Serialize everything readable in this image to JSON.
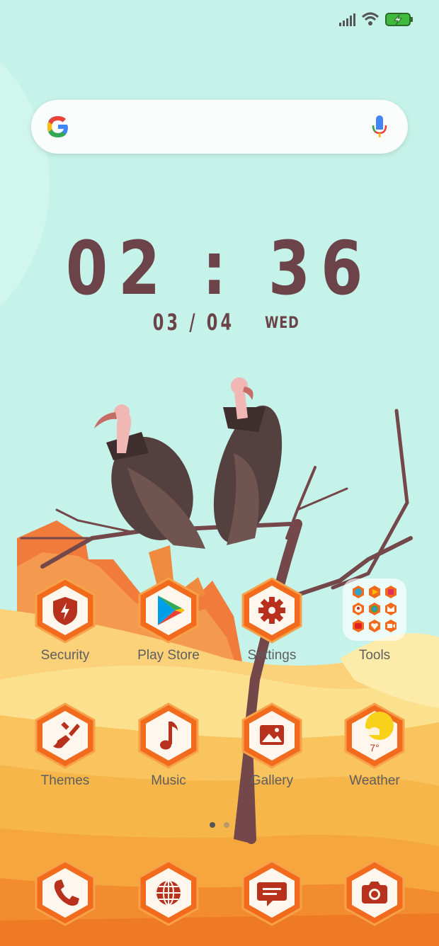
{
  "status_bar": {
    "icons": [
      "signal-icon",
      "wifi-icon",
      "battery-charging-icon"
    ]
  },
  "search": {
    "logo": "google-g-icon",
    "voice": "microphone-icon"
  },
  "clock": {
    "time": "02 : 36",
    "date": "03 / 04",
    "weekday": "WED"
  },
  "apps": {
    "security": "Security",
    "play_store": "Play Store",
    "settings": "Settings",
    "tools": "Tools",
    "themes": "Themes",
    "music": "Music",
    "gallery": "Gallery",
    "weather": "Weather",
    "weather_temp": "7°"
  },
  "page_indicator": {
    "pages": 2,
    "current": 1
  },
  "dock": [
    "phone-icon",
    "browser-icon",
    "messages-icon",
    "camera-icon"
  ],
  "colors": {
    "hex_orange": "#f26b1d",
    "hex_inner": "#fff6ee",
    "glyph_red": "#b8311c",
    "clock_text": "#6b4348",
    "sky": "#c8f4ea"
  }
}
